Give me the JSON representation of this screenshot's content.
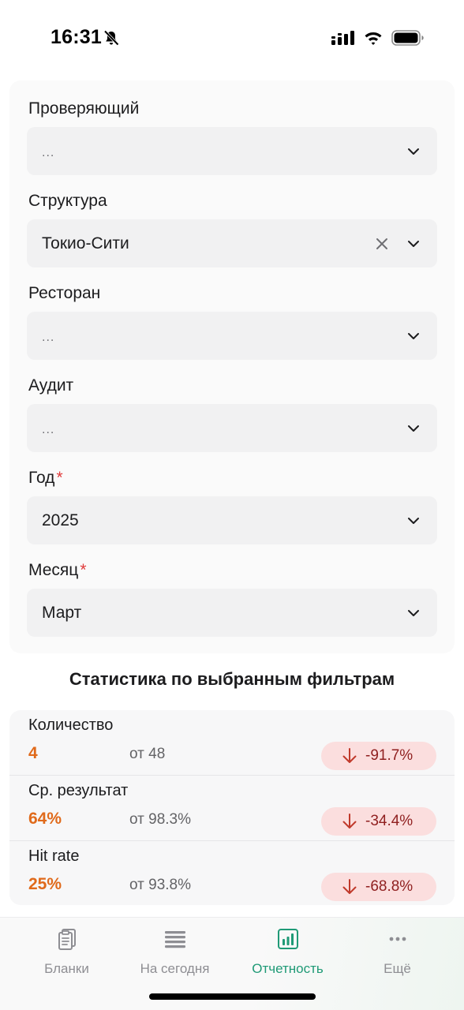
{
  "status_bar": {
    "time": "16:31"
  },
  "filters": [
    {
      "label": "Проверяющий",
      "value": "...",
      "placeholder": true,
      "required": false,
      "clearable": false
    },
    {
      "label": "Структура",
      "value": "Токио-Сити",
      "placeholder": false,
      "required": false,
      "clearable": true
    },
    {
      "label": "Ресторан",
      "value": "...",
      "placeholder": true,
      "required": false,
      "clearable": false
    },
    {
      "label": "Аудит",
      "value": "...",
      "placeholder": true,
      "required": false,
      "clearable": false
    },
    {
      "label": "Год",
      "value": "2025",
      "placeholder": false,
      "required": true,
      "clearable": false
    },
    {
      "label": "Месяц",
      "value": "Март",
      "placeholder": false,
      "required": true,
      "clearable": false
    }
  ],
  "required_mark": "*",
  "stats": {
    "title": "Статистика по выбранным фильтрам",
    "rows": [
      {
        "label": "Количество",
        "value": "4",
        "base": "от 48",
        "delta": "-91.7%"
      },
      {
        "label": "Ср. результат",
        "value": "64%",
        "base": "от 98.3%",
        "delta": "-34.4%"
      },
      {
        "label": "Hit rate",
        "value": "25%",
        "base": "от 93.8%",
        "delta": "-68.8%"
      }
    ]
  },
  "tab_bar": {
    "tabs": [
      {
        "label": "Бланки",
        "icon": "clipboard-icon",
        "active": false
      },
      {
        "label": "На сегодня",
        "icon": "list-icon",
        "active": false
      },
      {
        "label": "Отчетность",
        "icon": "bar-chart-icon",
        "active": true
      },
      {
        "label": "Ещё",
        "icon": "more-icon",
        "active": false
      }
    ]
  },
  "colors": {
    "accent": "#1f9a76",
    "value_orange": "#e06a1b",
    "negative_badge": "#fbdede",
    "negative_text": "#8f1f1f",
    "required": "#e03b3b"
  }
}
